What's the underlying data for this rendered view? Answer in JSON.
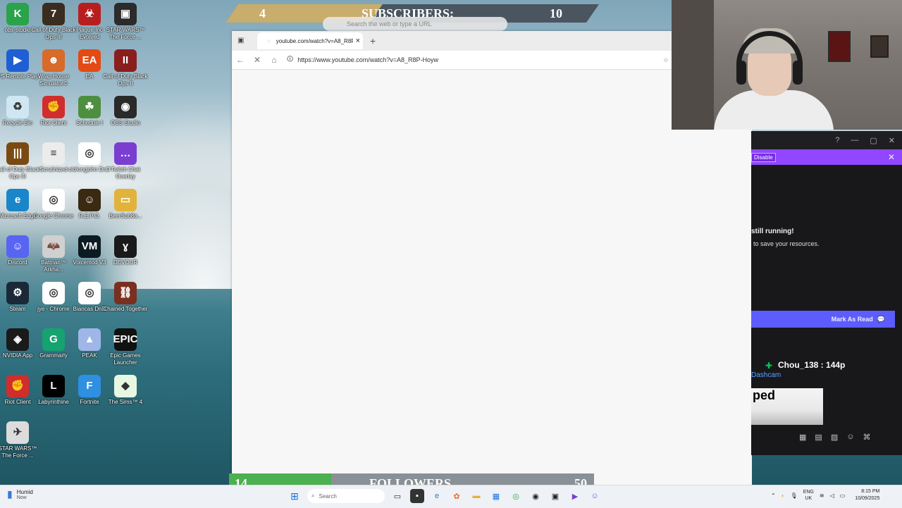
{
  "desktop": {
    "icons": [
      {
        "label": "obs-studio",
        "bg": "#2aa34a",
        "glyph": "K"
      },
      {
        "label": "Call of Duty Black Ops III",
        "bg": "#3a2d1f",
        "glyph": "7"
      },
      {
        "label": "Plague Inc Evolved",
        "bg": "#b81e1e",
        "glyph": "☣"
      },
      {
        "label": "STAR WARS™ The Force ...",
        "bg": "#2b2b2b",
        "glyph": "▣"
      },
      {
        "label": "PS Remote Play",
        "bg": "#1f5fd3",
        "glyph": "▶"
      },
      {
        "label": "Wrap House Simulator©",
        "bg": "#d86a2a",
        "glyph": "☻"
      },
      {
        "label": "EA",
        "bg": "#e34a14",
        "glyph": "EA"
      },
      {
        "label": "Call of Duty Black Ops II",
        "bg": "#8a1e1e",
        "glyph": "II"
      },
      {
        "label": "Recycle Bin",
        "bg": "#cfe7f2",
        "glyph": "♻"
      },
      {
        "label": "Riot Client",
        "bg": "#d12d2d",
        "glyph": "✊"
      },
      {
        "label": "Schedule I",
        "bg": "#4d8f3f",
        "glyph": "☘"
      },
      {
        "label": "OBS Studio",
        "bg": "#2a2a2a",
        "glyph": "◉"
      },
      {
        "label": "Call of Duty Black Ops III",
        "bg": "#7a4a12",
        "glyph": "|||"
      },
      {
        "label": "Scrutinized",
        "bg": "#ececec",
        "glyph": "≡"
      },
      {
        "label": "oldlongjohn DnD",
        "bg": "#ffffff",
        "glyph": "◎"
      },
      {
        "label": "Twitch Chat Overlay",
        "bg": "#7a3fd1",
        "glyph": "…"
      },
      {
        "label": "Microsoft Edge",
        "bg": "#1a86c9",
        "glyph": "e"
      },
      {
        "label": "Google Chrome",
        "bg": "#ffffff",
        "glyph": "◎"
      },
      {
        "label": "R.E.P.O.",
        "bg": "#3a2a12",
        "glyph": "☺"
      },
      {
        "label": "BeerSub8a...",
        "bg": "#e2b33a",
        "glyph": "▭"
      },
      {
        "label": "Discord",
        "bg": "#5865f2",
        "glyph": "☺"
      },
      {
        "label": "Batman™ Arkha...",
        "bg": "#d0d0d0",
        "glyph": "🦇"
      },
      {
        "label": "Voicemod V3",
        "bg": "#0b1b22",
        "glyph": "VM"
      },
      {
        "label": "DEVOUR",
        "bg": "#1a1a1a",
        "glyph": "ɣ"
      },
      {
        "label": "Steam",
        "bg": "#1b2838",
        "glyph": "⚙"
      },
      {
        "label": "jye - Chrome",
        "bg": "#ffffff",
        "glyph": "◎"
      },
      {
        "label": "Biancas DnD",
        "bg": "#ffffff",
        "glyph": "◎"
      },
      {
        "label": "Chained Together",
        "bg": "#7a2f1f",
        "glyph": "⛓"
      },
      {
        "label": "NVIDIA App",
        "bg": "#1a1a1a",
        "glyph": "◈"
      },
      {
        "label": "Grammarly",
        "bg": "#15a370",
        "glyph": "G"
      },
      {
        "label": "PEAK",
        "bg": "#9fb6e8",
        "glyph": "▲"
      },
      {
        "label": "Epic Games Launcher",
        "bg": "#111111",
        "glyph": "EPIC"
      },
      {
        "label": "Riot Client",
        "bg": "#d12d2d",
        "glyph": "✊"
      },
      {
        "label": "Labyrinthine",
        "bg": "#000000",
        "glyph": "L"
      },
      {
        "label": "Fortnite",
        "bg": "#2f8fe0",
        "glyph": "F"
      },
      {
        "label": "The Sims™ 4",
        "bg": "#e8f7e1",
        "glyph": "◆"
      },
      {
        "label": "STAR WARS™ The Force ...",
        "bg": "#dcdcdc",
        "glyph": "✈"
      }
    ]
  },
  "subscribers_bar": {
    "current": "4",
    "label": "SUBSCRIBERS:",
    "goal": "10",
    "fill_fraction": 0.4
  },
  "followers_bar": {
    "current": "14",
    "label": "FOLLOWERS",
    "goal": "50",
    "fill_fraction": 0.28
  },
  "browser": {
    "tab_title": "youtube.com/watch?v=A8_R8P-H",
    "url": "https://www.youtube.com/watch?v=A8_R8P-Hoyw",
    "search_placeholder": "Search the web or type a URL"
  },
  "twitch_panel": {
    "disable_label": "Disable",
    "running_text": "still running!",
    "save_text": "to save your resources.",
    "mark_read": "Mark As Read",
    "chat_user": "Chou_138 : 144p",
    "chat_tag": "Dashcam",
    "thumb_text": "ped"
  },
  "taskbar": {
    "weather": "Humid",
    "weather_sub": "Now",
    "search_label": "Search",
    "lang_top": "ENG",
    "lang_bottom": "UK",
    "time": "8:15 PM",
    "date": "10/09/2025"
  }
}
